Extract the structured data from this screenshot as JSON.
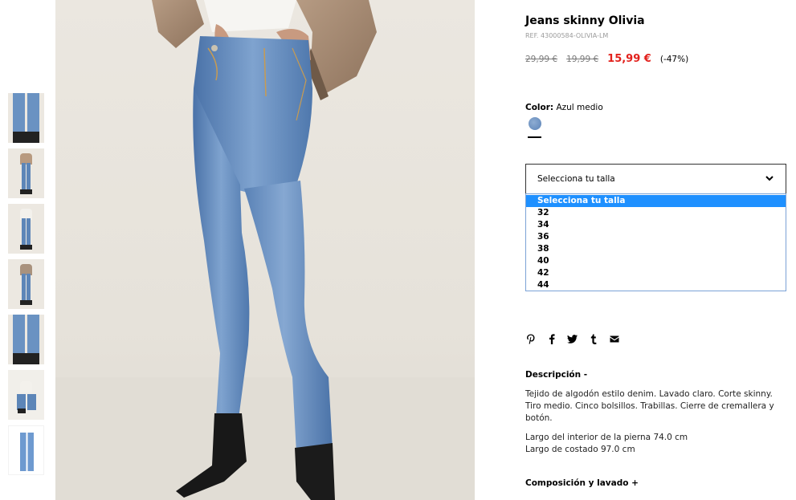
{
  "product": {
    "title": "Jeans skinny Olivia",
    "ref": "REF. 43000584-OLIVIA-LM",
    "price_original": "29,99 €",
    "price_previous": "19,99 €",
    "price_current": "15,99 €",
    "discount": "(-47%)",
    "color_label": "Color:",
    "color_value": "Azul medio"
  },
  "size_select": {
    "selected": "Selecciona tu talla",
    "options": [
      "Selecciona tu talla",
      "32",
      "34",
      "36",
      "38",
      "40",
      "42",
      "44"
    ]
  },
  "share_icons": [
    "pinterest-icon",
    "facebook-icon",
    "twitter-icon",
    "tumblr-icon",
    "email-icon"
  ],
  "description": {
    "heading": "Descripción -",
    "paragraph1": "Tejido de algodón estilo denim. Lavado claro. Corte skinny. Tiro medio. Cinco bolsillos. Trabillas. Cierre de cremallera y botón.",
    "line1": "Largo del interior de la pierna 74.0 cm",
    "line2": "Largo de costado 97.0 cm"
  },
  "composition": {
    "heading": "Composición y lavado +"
  },
  "colors": {
    "price_red": "#e2211c",
    "select_highlight": "#1e90ff",
    "denim": "#5d86b8"
  }
}
